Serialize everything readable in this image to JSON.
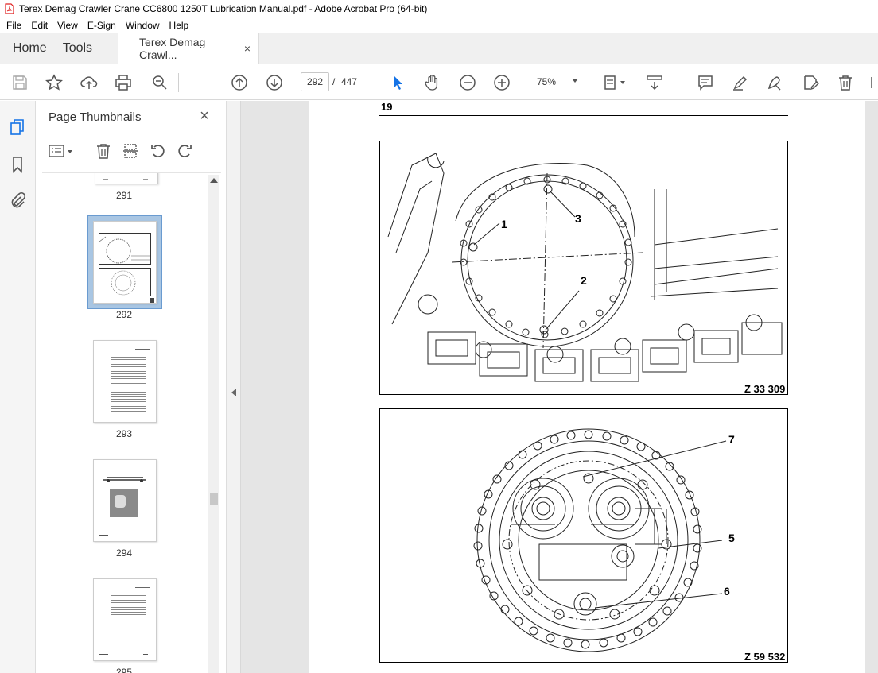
{
  "window": {
    "title": "Terex Demag Crawler Crane CC6800 1250T Lubrication Manual.pdf - Adobe Acrobat Pro (64-bit)"
  },
  "menu": [
    "File",
    "Edit",
    "View",
    "E-Sign",
    "Window",
    "Help"
  ],
  "tabs": {
    "home": "Home",
    "tools": "Tools",
    "document": "Terex Demag Crawl...",
    "close_glyph": "×"
  },
  "toolbar": {
    "current_page": "292",
    "separator": "/",
    "total_pages": "447",
    "zoom": "75%"
  },
  "thumbnails": {
    "panel_title": "Page Thumbnails",
    "close_glyph": "×",
    "selected_page": "292",
    "pages": [
      "291",
      "292",
      "293",
      "294",
      "295"
    ]
  },
  "document": {
    "page_section": "19",
    "figure1": {
      "code": "Z 33 309",
      "callouts": [
        "1",
        "3",
        "2"
      ]
    },
    "figure2": {
      "code": "Z 59 532",
      "callouts": [
        "7",
        "5",
        "6"
      ]
    }
  },
  "colors": {
    "accent": "#1473e6",
    "selection": "#a9c6e3",
    "acrobat_red": "#e02020"
  }
}
